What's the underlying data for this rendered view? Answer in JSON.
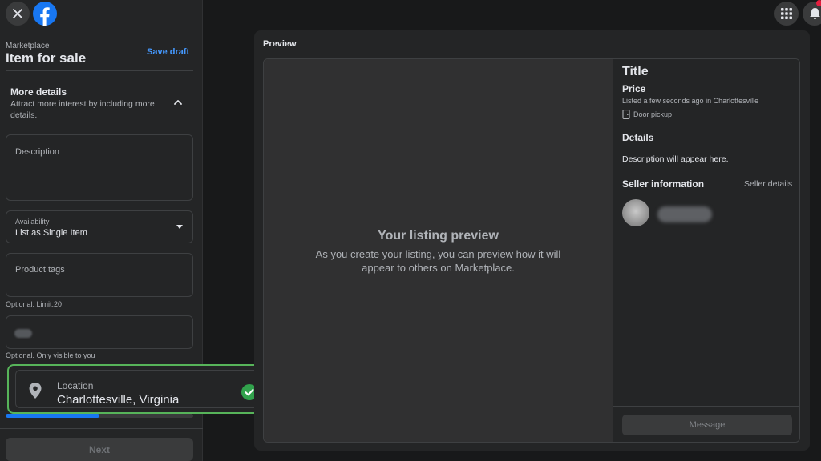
{
  "sidebar": {
    "breadcrumb": "Marketplace",
    "title": "Item for sale",
    "save_draft": "Save draft",
    "more_details": {
      "title": "More details",
      "subtitle": "Attract more interest by including more details."
    },
    "description": {
      "label": "Description"
    },
    "availability": {
      "label": "Availability",
      "value": "List as Single Item"
    },
    "product_tags": {
      "label": "Product tags",
      "hint": "Optional. Limit:20"
    },
    "sku": {
      "hint": "Optional. Only visible to you"
    },
    "location": {
      "label": "Location",
      "value": "Charlottesville, Virginia"
    },
    "progress_fraction": 0.5,
    "next_label": "Next"
  },
  "header": {
    "menu_icon": "grid-menu-icon",
    "notification_icon": "bell-icon"
  },
  "preview": {
    "heading": "Preview",
    "image_title": "Your listing preview",
    "image_text": "As you create your listing, you can preview how it will appear to others on Marketplace.",
    "title": "Title",
    "price": "Price",
    "listed": "Listed a few seconds ago in Charlottesville",
    "pickup": "Door pickup",
    "details_heading": "Details",
    "description_placeholder": "Description will appear here.",
    "seller_heading": "Seller information",
    "seller_details_link": "Seller details",
    "message_button": "Message"
  },
  "colors": {
    "accent": "#1877f2",
    "link": "#4599ff",
    "success": "#57b45a",
    "background": "#18191a",
    "surface": "#242526"
  }
}
